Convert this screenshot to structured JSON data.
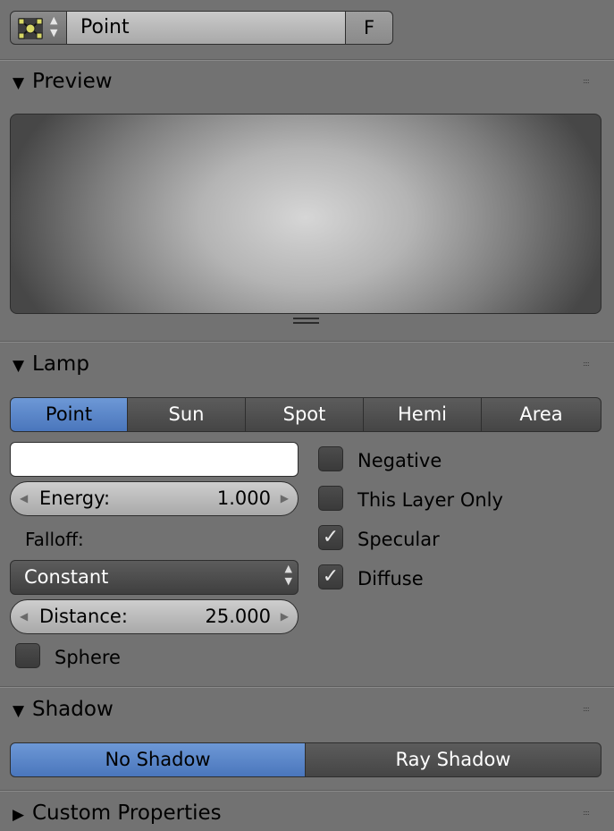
{
  "datablock": {
    "name": "Point",
    "fake_user_label": "F",
    "icon": "lamp-point-icon"
  },
  "panels": {
    "preview": {
      "title": "Preview",
      "expanded": true
    },
    "lamp": {
      "title": "Lamp",
      "expanded": true,
      "types": [
        "Point",
        "Sun",
        "Spot",
        "Hemi",
        "Area"
      ],
      "active_type": "Point",
      "color": "#ffffff",
      "energy": {
        "label": "Energy:",
        "value": "1.000"
      },
      "falloff_label": "Falloff:",
      "falloff_value": "Constant",
      "distance": {
        "label": "Distance:",
        "value": "25.000"
      },
      "sphere": {
        "label": "Sphere",
        "checked": false
      },
      "negative": {
        "label": "Negative",
        "checked": false
      },
      "this_layer_only": {
        "label": "This Layer Only",
        "checked": false
      },
      "specular": {
        "label": "Specular",
        "checked": true
      },
      "diffuse": {
        "label": "Diffuse",
        "checked": true
      }
    },
    "shadow": {
      "title": "Shadow",
      "expanded": true,
      "options": [
        "No Shadow",
        "Ray Shadow"
      ],
      "active": "No Shadow"
    },
    "custom_properties": {
      "title": "Custom Properties",
      "expanded": false
    }
  },
  "colors": {
    "background": "#727272",
    "accent": "#5683c8",
    "field": "#bdbdbd"
  }
}
